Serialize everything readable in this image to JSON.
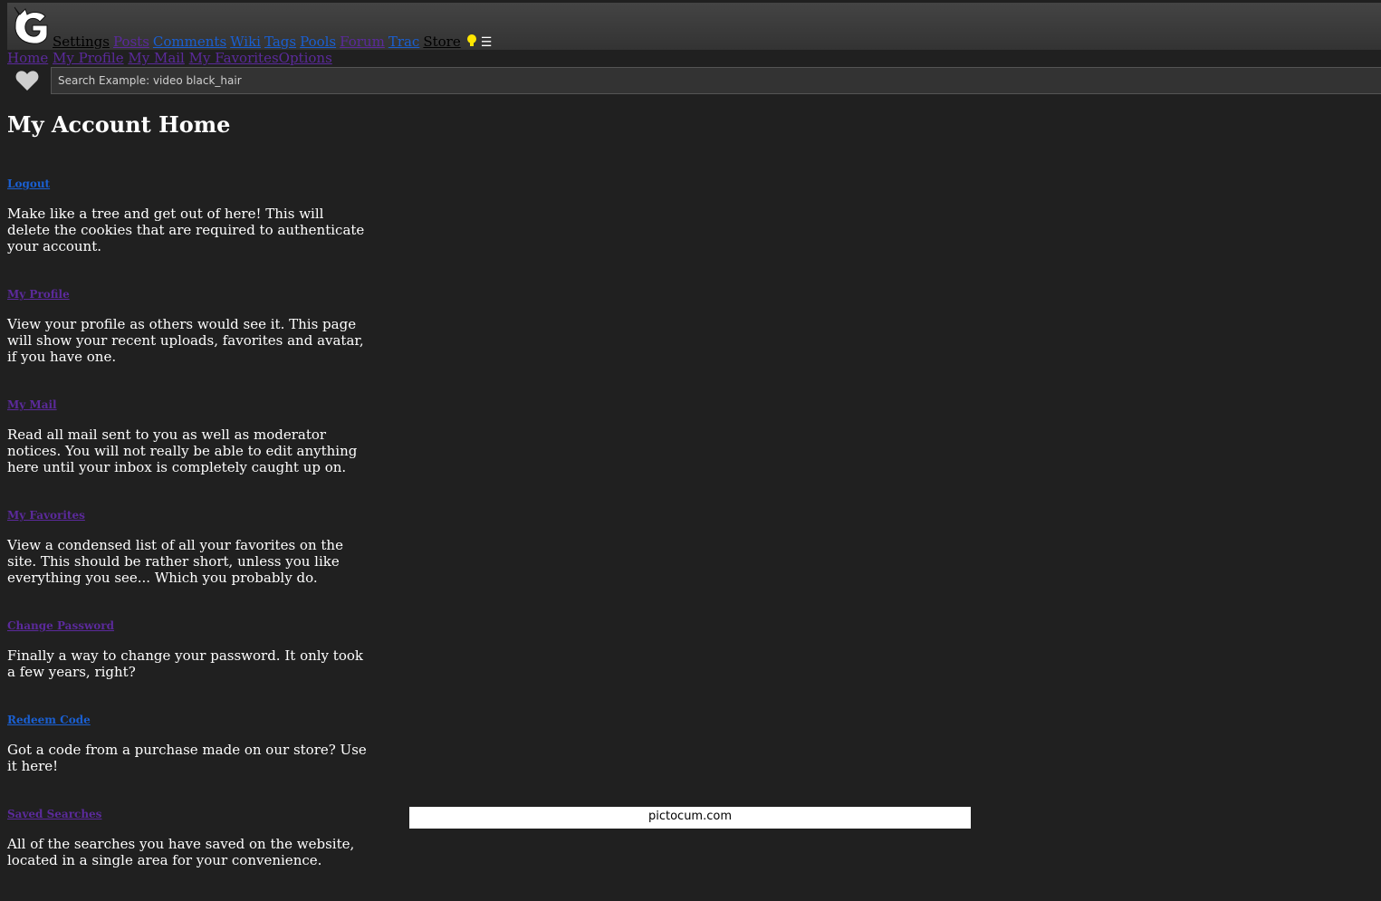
{
  "header": {
    "logo_icon": "g-logo-icon",
    "nav": [
      {
        "label": "Settings",
        "color": "#000000"
      },
      {
        "label": "Posts",
        "color": "#5b2a9b"
      },
      {
        "label": "Comments",
        "color": "#1a5fd1"
      },
      {
        "label": "Wiki",
        "color": "#1a5fd1"
      },
      {
        "label": "Tags",
        "color": "#1a5fd1"
      },
      {
        "label": "Pools",
        "color": "#1a5fd1"
      },
      {
        "label": "Forum",
        "color": "#5b2a9b"
      },
      {
        "label": "Trac",
        "color": "#1a5fd1"
      },
      {
        "label": "Store",
        "color": "#000000"
      }
    ],
    "theme_icon": "lightbulb-icon",
    "menu_icon": "hamburger-menu-icon",
    "menu_glyph": "☰"
  },
  "subnav": [
    "Home",
    "My Profile",
    "My Mail",
    "My Favorites",
    "Options"
  ],
  "search": {
    "placeholder": "Search Example: video black_hair",
    "favorite_icon": "heart-icon"
  },
  "main": {
    "title": "My Account Home",
    "sections": [
      {
        "link": "Logout",
        "color": "#1a5fd1",
        "desc": "Make like a tree and get out of here! This will delete the cookies that are required to authenticate your account."
      },
      {
        "link": "My Profile",
        "color": "#5b2a9b",
        "desc": "View your profile as others would see it. This page will show your recent uploads, favorites and avatar, if you have one."
      },
      {
        "link": "My Mail",
        "color": "#5b2a9b",
        "desc": "Read all mail sent to you as well as moderator notices. You will not really be able to edit anything here until your inbox is completely caught up on."
      },
      {
        "link": "My Favorites",
        "color": "#5b2a9b",
        "desc": "View a condensed list of all your favorites on the site. This should be rather short, unless you like everything you see... Which you probably do."
      },
      {
        "link": "Change Password",
        "color": "#5b2a9b",
        "desc": "Finally a way to change your password. It only took a few years, right?"
      },
      {
        "link": "Redeem Code",
        "color": "#1a5fd1",
        "desc": "Got a code from a purchase made on our store? Use it here!"
      },
      {
        "link": "Saved Searches",
        "color": "#5b2a9b",
        "desc": "All of the searches you have saved on the website, located in a single area for your convenience."
      }
    ]
  },
  "footer": {
    "watermark": "pictocum.com"
  }
}
